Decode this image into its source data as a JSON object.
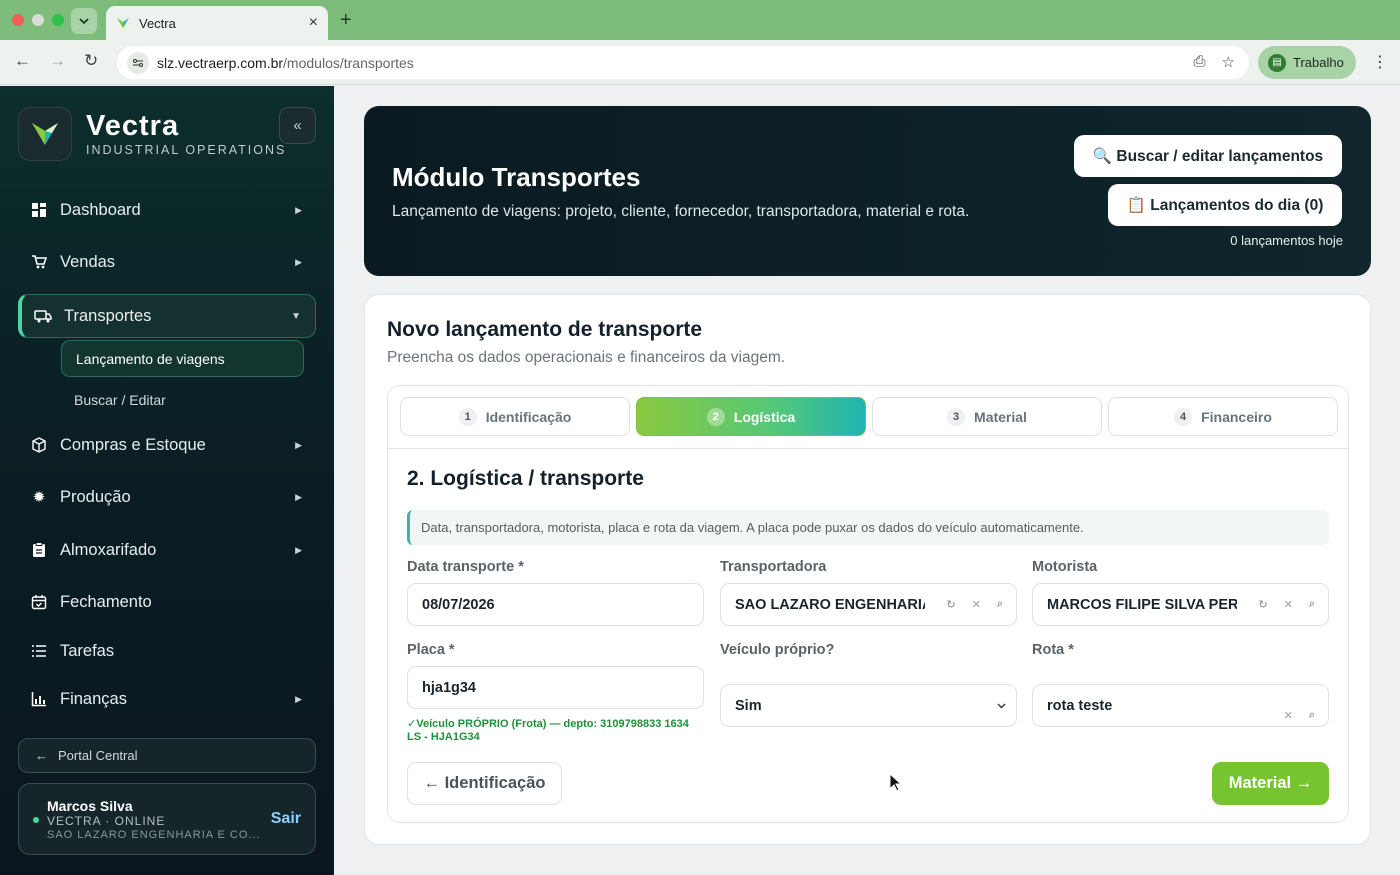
{
  "browser": {
    "tab_title": "Vectra",
    "url_host": "slz.vectraerp.com.br",
    "url_path": "/modulos/transportes",
    "profile": "Trabalho",
    "colors": {
      "frame": "#7dbc7a"
    }
  },
  "sidebar": {
    "brand": "Vectra",
    "brand_sub": "INDUSTRIAL OPERATIONS",
    "collapse_icon": "chevrons-left-icon",
    "items": [
      {
        "label": "Dashboard",
        "icon": "dashboard-icon"
      },
      {
        "label": "Vendas",
        "icon": "cart-icon"
      },
      {
        "label": "Transportes",
        "icon": "truck-icon",
        "active": true
      },
      {
        "label": "Compras e Estoque",
        "icon": "box-icon"
      },
      {
        "label": "Produção",
        "icon": "gear-icon"
      },
      {
        "label": "Almoxarifado",
        "icon": "clipboard-icon"
      },
      {
        "label": "Fechamento",
        "icon": "calendar-icon"
      },
      {
        "label": "Tarefas",
        "icon": "list-icon"
      },
      {
        "label": "Finanças",
        "icon": "chart-icon"
      }
    ],
    "subitems": [
      {
        "label": "Lançamento de viagens",
        "active": true
      },
      {
        "label": "Buscar / Editar"
      }
    ],
    "portal": "Portal Central",
    "user": {
      "name": "Marcos Silva",
      "status": "VECTRA · ONLINE",
      "company": "SAO LAZARO ENGENHARIA E CO...",
      "logout": "Sair"
    }
  },
  "hero": {
    "title": "Módulo Transportes",
    "subtitle": "Lançamento de viagens: projeto, cliente, fornecedor, transportadora, material e rota.",
    "search_button": "🔍 Buscar / editar lançamentos",
    "today_button": "📋 Lançamentos do dia (0)",
    "today_count": "0 lançamentos hoje"
  },
  "form": {
    "title": "Novo lançamento de transporte",
    "subtitle": "Preencha os dados operacionais e financeiros da viagem.",
    "steps": [
      {
        "num": "1",
        "label": "Identificação"
      },
      {
        "num": "2",
        "label": "Logística",
        "active": true
      },
      {
        "num": "3",
        "label": "Material"
      },
      {
        "num": "4",
        "label": "Financeiro"
      }
    ],
    "section_title": "2. Logística / transporte",
    "info": "Data, transportadora, motorista, placa e rota da viagem. A placa pode puxar os dados do veículo automaticamente.",
    "fields": {
      "data": {
        "label": "Data transporte *",
        "value": "08/07/2026"
      },
      "transportadora": {
        "label": "Transportadora",
        "value": "SAO LAZARO ENGENHARIA E"
      },
      "motorista": {
        "label": "Motorista",
        "value": "MARCOS FILIPE SILVA PEREII"
      },
      "placa": {
        "label": "Placa *",
        "value": "hja1g34",
        "hint": "✓Veículo PRÓPRIO (Frota) — depto: 3109798833 1634 LS - HJA1G34"
      },
      "veiculo": {
        "label": "Veículo próprio?",
        "value": "Sim"
      },
      "rota": {
        "label": "Rota *",
        "value": "rota teste"
      }
    },
    "back_button": "← Identificação",
    "next_button": "Material →"
  }
}
